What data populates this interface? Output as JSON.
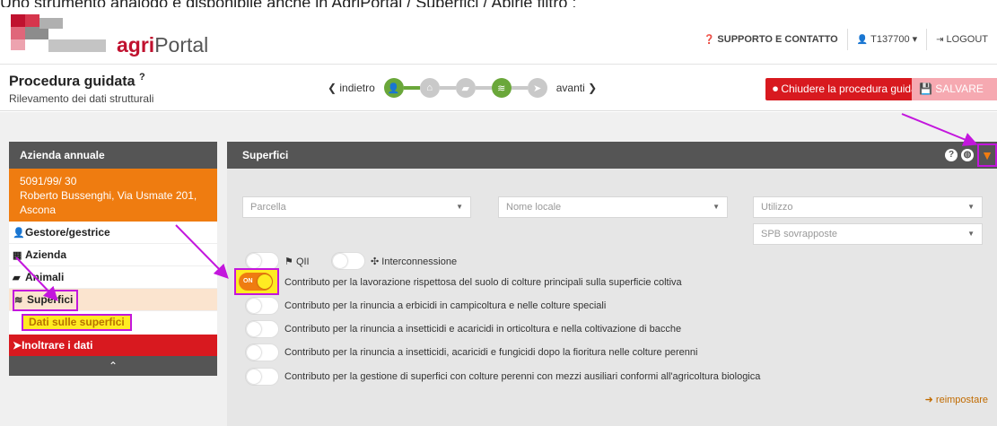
{
  "caption": "Uno strumento analogo è disponibile anche in AgriPortal / Superfici / Apirle filtro :",
  "brand": {
    "prefix": "agri",
    "suffix": "Portal",
    "colors": {
      "red": "#c0122f",
      "gray": "#999999"
    }
  },
  "header_links": [
    {
      "icon": "question-circle-icon",
      "label": "SUPPORTO E CONTATTO"
    },
    {
      "icon": "user-icon",
      "label": "T137700"
    },
    {
      "icon": "logout-icon",
      "label": "LOGOUT"
    }
  ],
  "procedure": {
    "title": "Procedura guidata",
    "subtitle": "Rilevamento dei dati strutturali",
    "back": "indietro",
    "forward": "avanti",
    "close_button": "Chiudere la procedura guidata",
    "save_button": "SALVARE"
  },
  "steps": [
    {
      "icon": "user-icon",
      "done": true
    },
    {
      "icon": "house-icon",
      "done": false
    },
    {
      "icon": "cow-icon",
      "done": false
    },
    {
      "icon": "layers-icon",
      "done": true
    },
    {
      "icon": "send-icon",
      "done": false
    }
  ],
  "sidebar": {
    "header": "Azienda annuale",
    "farm_id": "5091/99/ 30",
    "farm_address": "Roberto Bussenghi, Via Usmate 201, Ascona",
    "items": [
      {
        "icon": "user-icon",
        "label": "Gestore/gestrice"
      },
      {
        "icon": "building-icon",
        "label": "Azienda"
      },
      {
        "icon": "cow-icon",
        "label": "Animali"
      },
      {
        "icon": "layers-icon",
        "label": "Superfici"
      }
    ],
    "sub_item": "Dati sulle superfici",
    "send_label": "Inoltrare i dati"
  },
  "panel": {
    "title": "Superfici",
    "filters": {
      "parcel_placeholder": "Parcella",
      "local_name_placeholder": "Nome locale",
      "use_placeholder": "Utilizzo",
      "spb_placeholder": "SPB sovrapposte",
      "qii_label": "QII",
      "interconnection_label": "Interconnessione"
    },
    "toggle_on_text": "ON",
    "contributions": [
      {
        "label": "Contributo per la lavorazione rispettosa del suolo di colture principali sulla superficie coltiva",
        "on": true
      },
      {
        "label": "Contributo per la rinuncia a erbicidi in campicoltura e nelle colture speciali",
        "on": false
      },
      {
        "label": "Contributo per la rinuncia a insetticidi e acaricidi in orticoltura e nella coltivazione di bacche",
        "on": false
      },
      {
        "label": "Contributo per la rinuncia a insetticidi, acaricidi e fungicidi dopo la fioritura nelle colture perenni",
        "on": false
      },
      {
        "label": "Contributo per la gestione di superfici con colture perenni con mezzi ausiliari conformi all'agricoltura biologica",
        "on": false
      }
    ],
    "reset_label": "reimpostare"
  }
}
